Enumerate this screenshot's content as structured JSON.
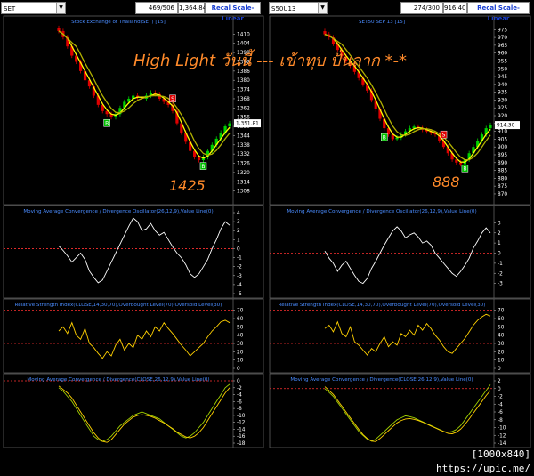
{
  "left_panel": {
    "symbol": "SET",
    "counter": "469/506",
    "last_price": "1,364.84",
    "recal_label": "Recal Scale-Linear",
    "price_title": "Stock Exchange of Thailand(SET) [15]",
    "macd_title": "Moving Average Convergence / Divergence Oscillator(26,12,9),Value Line(0)",
    "rsi_title": "Relative Strength Index(CLOSE,14,30,70),Overbought Level(70),Oversold Level(30)",
    "macd2_title": "Moving Average Convergence / Divergence(CLOSE,26,12,9),Value Line(0)",
    "price_tag": "1,351.81",
    "annotation_low": "1425"
  },
  "right_panel": {
    "symbol": "S50U13",
    "counter": "274/300",
    "last_price": "916.40",
    "recal_label": "Recal Scale-Linear",
    "price_title": "SET50 SEP 13  [15]",
    "macd_title": "Moving Average Convergence / Divergence Oscillator(26,12,9),Value Line(0)",
    "rsi_title": "Relative Strength Index(CLOSE,14,30,70),Overbought Level(70),Oversold Level(30)",
    "macd2_title": "Moving Average Convergence / Divergence(CLOSE,26,12,9),Value Line(0)",
    "price_tag": "914.30",
    "annotation_low": "888"
  },
  "headline": "High Light วันนี้ --- เข้าทุบ ปั่นลาก *-*",
  "watermark": "[1000x840] https://upic.me/",
  "colors": {
    "background": "#000000",
    "up_bar": "#00d000",
    "down_bar": "#e00000",
    "ma_fast": "#ffff00",
    "ma_slow": "#b0b000",
    "macd_line": "#ffffff",
    "rsi_line": "#ffd000",
    "macd2_line_a": "#a0d000",
    "macd2_line_b": "#ffd000",
    "reference_line": "#ff3030",
    "annotation": "#ff8a2a",
    "sell_marker": "#e00000",
    "buy_marker": "#00c000"
  },
  "chart_data": [
    {
      "panel": "left-price",
      "type": "line",
      "title": "Stock Exchange of Thailand(SET) [15]",
      "ylim": [
        1302,
        1416
      ],
      "yticks": [
        1410,
        1404,
        1398,
        1392,
        1386,
        1380,
        1374,
        1368,
        1362,
        1356,
        1350,
        1344,
        1338,
        1332,
        1326,
        1320,
        1314,
        1308
      ],
      "close": [
        1412,
        1408,
        1402,
        1396,
        1392,
        1386,
        1380,
        1376,
        1370,
        1364,
        1360,
        1358,
        1356,
        1358,
        1362,
        1366,
        1368,
        1370,
        1369,
        1368,
        1370,
        1372,
        1371,
        1368,
        1366,
        1364,
        1360,
        1352,
        1346,
        1340,
        1334,
        1330,
        1328,
        1330,
        1334,
        1338,
        1342,
        1346,
        1350,
        1352
      ],
      "markers": [
        {
          "label": "S",
          "type": "sell",
          "bar": 26
        },
        {
          "label": "B",
          "type": "buy",
          "bar": 11
        },
        {
          "label": "B",
          "type": "buy",
          "bar": 33
        }
      ]
    },
    {
      "panel": "left-macd",
      "type": "line",
      "title": "Moving Average Convergence / Divergence Oscillator(26,12,9),Value Line(0)",
      "ylim": [
        -5,
        4
      ],
      "yticks": [
        4,
        3,
        2,
        1,
        0,
        -1,
        -2,
        -3,
        -4,
        -5
      ],
      "values": [
        0.3,
        -0.2,
        -0.8,
        -1.5,
        -1.0,
        -0.5,
        -1.2,
        -2.5,
        -3.2,
        -3.8,
        -3.5,
        -2.5,
        -1.5,
        -0.5,
        0.5,
        1.5,
        2.5,
        3.4,
        3.0,
        2.0,
        2.2,
        2.8,
        2.0,
        1.5,
        1.8,
        1.0,
        0.2,
        -0.5,
        -1.0,
        -1.8,
        -2.8,
        -3.2,
        -2.8,
        -2.0,
        -1.2,
        0.0,
        1.0,
        2.2,
        3.0,
        2.6
      ]
    },
    {
      "panel": "left-rsi",
      "type": "line",
      "title": "Relative Strength Index(CLOSE,14,30,70),Overbought Level(70),Oversold Level(30)",
      "ylim": [
        0,
        75
      ],
      "yticks": [
        70,
        60,
        50,
        40,
        30,
        20,
        10,
        0
      ],
      "levels": [
        70,
        30
      ],
      "values": [
        45,
        50,
        42,
        55,
        40,
        35,
        48,
        30,
        25,
        18,
        12,
        20,
        15,
        28,
        35,
        22,
        30,
        25,
        40,
        35,
        45,
        38,
        50,
        45,
        55,
        48,
        42,
        35,
        28,
        22,
        15,
        20,
        25,
        30,
        38,
        45,
        50,
        56,
        58,
        55
      ]
    },
    {
      "panel": "left-macd2",
      "type": "line",
      "title": "Moving Average Convergence / Divergence(CLOSE,26,12,9),Value Line(0)",
      "ylim": [
        -18,
        0
      ],
      "yticks": [
        0,
        -2,
        -4,
        -6,
        -8,
        -10,
        -12,
        -14,
        -16,
        -18
      ],
      "series": [
        {
          "values": [
            -2,
            -3,
            -4.5,
            -6,
            -8,
            -10,
            -12,
            -14,
            -16,
            -17,
            -17.5,
            -17,
            -16,
            -14.5,
            -13,
            -12,
            -11,
            -10,
            -9.5,
            -9,
            -9.5,
            -10,
            -10.5,
            -11,
            -12,
            -13,
            -14,
            -15,
            -16,
            -16.5,
            -16,
            -15,
            -13.5,
            -12,
            -10,
            -8,
            -6,
            -4,
            -2,
            -1
          ]
        },
        {
          "values": [
            -1.5,
            -2.5,
            -3.5,
            -5,
            -7,
            -9,
            -11,
            -13,
            -15,
            -16.5,
            -17.5,
            -17.8,
            -17,
            -15.5,
            -14,
            -12.5,
            -11.5,
            -10.5,
            -10,
            -9.8,
            -10,
            -10.3,
            -10.8,
            -11.5,
            -12.2,
            -13,
            -13.8,
            -14.8,
            -15.5,
            -16.2,
            -16.5,
            -16,
            -15,
            -13.5,
            -11.5,
            -9.5,
            -7.5,
            -5.5,
            -3.5,
            -2
          ]
        }
      ]
    },
    {
      "panel": "right-price",
      "type": "line",
      "title": "SET50 SEP 13  [15]",
      "ylim": [
        866,
        978
      ],
      "yticks": [
        975,
        970,
        965,
        960,
        955,
        950,
        945,
        940,
        935,
        930,
        925,
        920,
        915,
        910,
        905,
        900,
        895,
        890,
        885,
        880,
        875,
        870
      ],
      "close": [
        972,
        970,
        966,
        962,
        958,
        955,
        952,
        948,
        944,
        940,
        936,
        930,
        924,
        918,
        912,
        908,
        905,
        906,
        908,
        910,
        912,
        913,
        912,
        911,
        910,
        909,
        908,
        904,
        900,
        896,
        892,
        890,
        889,
        892,
        896,
        900,
        904,
        908,
        912,
        914
      ],
      "markers": [
        {
          "label": "S",
          "type": "sell",
          "bar": 28
        },
        {
          "label": "B",
          "type": "buy",
          "bar": 14
        },
        {
          "label": "B",
          "type": "buy",
          "bar": 33
        }
      ]
    },
    {
      "panel": "right-macd",
      "type": "line",
      "title": "Moving Average Convergence / Divergence Oscillator(26,12,9),Value Line(0)",
      "ylim": [
        -4,
        4
      ],
      "yticks": [
        3,
        2,
        1,
        0,
        -1,
        -2,
        -3
      ],
      "values": [
        0.2,
        -0.5,
        -1.0,
        -1.8,
        -1.2,
        -0.8,
        -1.5,
        -2.2,
        -2.8,
        -3.0,
        -2.5,
        -1.5,
        -0.8,
        0.0,
        0.8,
        1.5,
        2.2,
        2.6,
        2.2,
        1.5,
        1.8,
        2.0,
        1.6,
        1.0,
        1.2,
        0.8,
        0.0,
        -0.5,
        -1.0,
        -1.5,
        -2.0,
        -2.3,
        -1.8,
        -1.2,
        -0.5,
        0.5,
        1.2,
        2.0,
        2.5,
        2.0
      ]
    },
    {
      "panel": "right-rsi",
      "type": "line",
      "title": "Relative Strength Index(CLOSE,14,30,70),Overbought Level(70),Oversold Level(30)",
      "ylim": [
        0,
        75
      ],
      "yticks": [
        70,
        60,
        50,
        40,
        30,
        20,
        10,
        0
      ],
      "levels": [
        70,
        30
      ],
      "values": [
        48,
        52,
        44,
        56,
        42,
        38,
        50,
        32,
        28,
        22,
        16,
        24,
        20,
        30,
        38,
        26,
        32,
        28,
        42,
        38,
        46,
        40,
        52,
        46,
        54,
        48,
        40,
        34,
        26,
        20,
        18,
        24,
        30,
        36,
        44,
        52,
        58,
        62,
        65,
        63
      ]
    },
    {
      "panel": "right-macd2",
      "type": "line",
      "title": "Moving Average Convergence / Divergence(CLOSE,26,12,9),Value Line(0)",
      "ylim": [
        -14,
        2
      ],
      "yticks": [
        2,
        0,
        -2,
        -4,
        -6,
        -8,
        -10,
        -12,
        -14
      ],
      "series": [
        {
          "values": [
            0,
            -1,
            -2,
            -3.5,
            -5,
            -6.5,
            -8,
            -9.5,
            -11,
            -12,
            -13,
            -13.5,
            -13,
            -12,
            -11,
            -10,
            -9,
            -8,
            -7.5,
            -7,
            -7.2,
            -7.5,
            -8,
            -8.5,
            -9,
            -9.5,
            -10,
            -10.5,
            -11,
            -11.2,
            -11,
            -10.5,
            -9.5,
            -8,
            -6.5,
            -5,
            -3.5,
            -2,
            -0.5,
            1
          ]
        },
        {
          "values": [
            0.5,
            -0.5,
            -1.5,
            -3,
            -4.5,
            -6,
            -7.5,
            -9,
            -10.5,
            -11.8,
            -12.8,
            -13.5,
            -13.6,
            -12.8,
            -11.8,
            -10.8,
            -9.8,
            -8.8,
            -8.2,
            -7.8,
            -7.7,
            -7.9,
            -8.2,
            -8.6,
            -9.1,
            -9.6,
            -10.1,
            -10.6,
            -11,
            -11.5,
            -11.6,
            -11.2,
            -10.4,
            -9.2,
            -7.8,
            -6.3,
            -4.8,
            -3.3,
            -1.8,
            -0.5
          ]
        }
      ]
    }
  ]
}
